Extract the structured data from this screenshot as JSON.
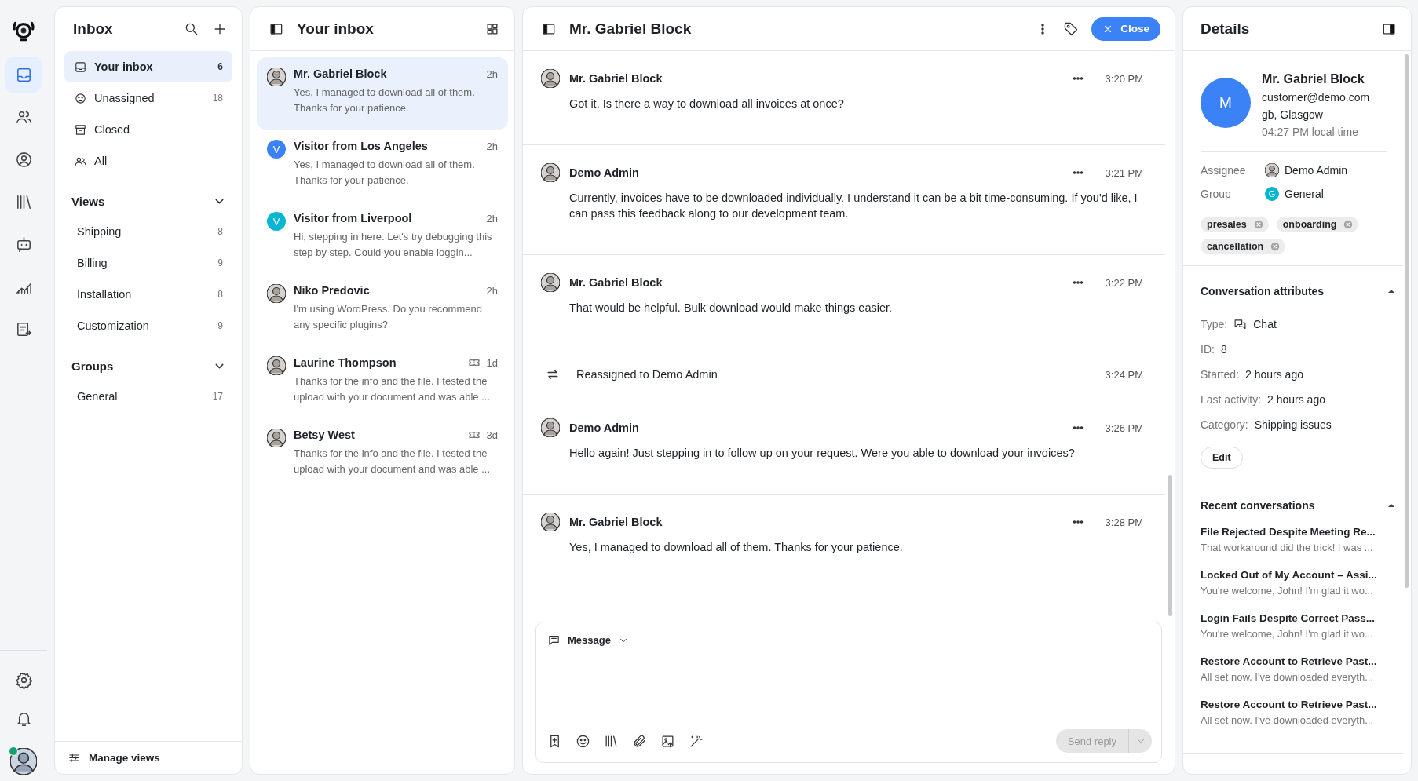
{
  "rail": {
    "items": [
      {
        "selected": true
      },
      {
        "selected": false
      },
      {
        "selected": false
      },
      {
        "selected": false
      },
      {
        "selected": false
      },
      {
        "selected": false
      },
      {
        "selected": false
      }
    ],
    "user": {
      "online": true
    }
  },
  "inbox": {
    "title": "Inbox",
    "items": [
      {
        "label": "Your inbox",
        "count": "6",
        "selected": true
      },
      {
        "label": "Unassigned",
        "count": "18",
        "selected": false
      },
      {
        "label": "Closed",
        "selected": false
      },
      {
        "label": "All",
        "selected": false
      }
    ],
    "views": {
      "title": "Views",
      "expanded": true,
      "items": [
        {
          "label": "Shipping",
          "count": "8"
        },
        {
          "label": "Billing",
          "count": "9"
        },
        {
          "label": "Installation",
          "count": "8"
        },
        {
          "label": "Customization",
          "count": "9"
        }
      ]
    },
    "groups": {
      "title": "Groups",
      "expanded": true,
      "items": [
        {
          "label": "General",
          "count": "17"
        }
      ]
    },
    "manage_views": "Manage views"
  },
  "conversations": {
    "title": "Your inbox",
    "items": [
      {
        "name": "Mr. Gabriel Block",
        "kind": "photo",
        "time": "2h",
        "preview": "Yes, I managed to download all of them. Thanks for your patience.",
        "selected": true,
        "ticket": false
      },
      {
        "name": "Visitor from Los Angeles",
        "kind": "letter",
        "letter": "V",
        "color": "#3b82f6",
        "time": "2h",
        "preview": "Yes, I managed to download all of them. Thanks for your patience.",
        "selected": false,
        "ticket": false
      },
      {
        "name": "Visitor from Liverpool",
        "kind": "letter",
        "letter": "V",
        "color": "#06b6d4",
        "time": "2h",
        "preview": "Hi, stepping in here. Let's try debugging this step by step. Could you enable loggin...",
        "selected": false,
        "ticket": false
      },
      {
        "name": "Niko Predovic",
        "kind": "photo",
        "time": "2h",
        "preview": "I'm using WordPress. Do you recommend any specific plugins?",
        "selected": false,
        "ticket": false
      },
      {
        "name": "Laurine Thompson",
        "kind": "photo",
        "time": "1d",
        "preview": "Thanks for the info and the file. I tested the upload with your document and was able ...",
        "selected": false,
        "ticket": true
      },
      {
        "name": "Betsy West",
        "kind": "photo",
        "time": "3d",
        "preview": "Thanks for the info and the file. I tested the upload with your document and was able ...",
        "selected": false,
        "ticket": true
      }
    ]
  },
  "chat": {
    "title": "Mr. Gabriel Block",
    "close": "Close",
    "messages": [
      {
        "kind": "message",
        "author": "Mr. Gabriel Block",
        "time": "3:20 PM",
        "text": "Got it. Is there a way to download all invoices at once?"
      },
      {
        "kind": "message",
        "author": "Demo Admin",
        "time": "3:21 PM",
        "text": "Currently, invoices have to be downloaded individually. I understand it can be a bit time-consuming. If you'd like, I can pass this feedback along to our development team."
      },
      {
        "kind": "message",
        "author": "Mr. Gabriel Block",
        "time": "3:22 PM",
        "text": "That would be helpful. Bulk download would make things easier."
      },
      {
        "kind": "event",
        "text": "Reassigned to Demo Admin",
        "time": "3:24 PM"
      },
      {
        "kind": "message",
        "author": "Demo Admin",
        "time": "3:26 PM",
        "text": "Hello again! Just stepping in to follow up on your request. Were you able to download your invoices?"
      },
      {
        "kind": "message",
        "author": "Mr. Gabriel Block",
        "time": "3:28 PM",
        "text": "Yes, I managed to download all of them. Thanks for your patience."
      }
    ],
    "composer": {
      "mode": "Message",
      "send": "Send reply",
      "send_disabled": true
    }
  },
  "details": {
    "title": "Details",
    "contact": {
      "initial": "M",
      "color": "#3b82f6",
      "name": "Mr. Gabriel Block",
      "email": "customer@demo.com",
      "location": "gb, Glasgow",
      "local_time": "04:27 PM local time"
    },
    "assignee": {
      "label": "Assignee",
      "value": "Demo Admin"
    },
    "group": {
      "label": "Group",
      "value": "General",
      "initial": "G",
      "color": "#06b6d4"
    },
    "tags": [
      "presales",
      "onboarding",
      "cancellation"
    ],
    "attributes": {
      "title": "Conversation attributes",
      "expanded": true,
      "rows": [
        {
          "label": "Type:",
          "value": "Chat",
          "kind": "chat"
        },
        {
          "label": "ID:",
          "value": "8",
          "kind": "plain"
        },
        {
          "label": "Started:",
          "value": "2 hours ago",
          "kind": "plain"
        },
        {
          "label": "Last activity:",
          "value": "2 hours ago",
          "kind": "plain"
        },
        {
          "label": "Category:",
          "value": "Shipping issues",
          "kind": "plain"
        }
      ],
      "edit": "Edit"
    },
    "recent": {
      "title": "Recent conversations",
      "expanded": true,
      "items": [
        {
          "title": "File Rejected Despite Meeting Re...",
          "preview": "That workaround did the trick! I was ..."
        },
        {
          "title": "Locked Out of My Account – Assi...",
          "preview": "You're welcome, John! I'm glad it wo..."
        },
        {
          "title": "Login Fails Despite Correct Pass...",
          "preview": "You're welcome, John! I'm glad it wo..."
        },
        {
          "title": "Restore Account to Retrieve Past...",
          "preview": "All set now. I've downloaded everyth..."
        },
        {
          "title": "Restore Account to Retrieve Past...",
          "preview": "All set now. I've downloaded everyth..."
        }
      ]
    }
  }
}
